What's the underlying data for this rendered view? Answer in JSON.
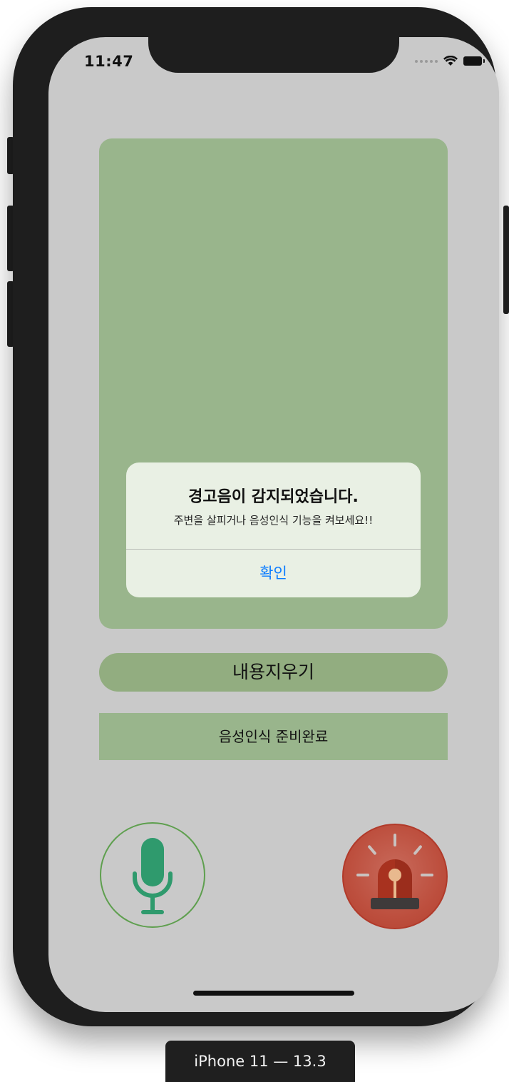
{
  "status_bar": {
    "time": "11:47"
  },
  "alert": {
    "title": "경고음이 감지되었습니다.",
    "message": "주변을 살피거나 음성인식 기능을 켜보세요!!",
    "confirm_label": "확인"
  },
  "controls": {
    "clear_label": "내용지우기",
    "speech_status": "음성인식 준비완료"
  },
  "icons": {
    "mic": "microphone-icon",
    "siren": "siren-icon"
  },
  "colors": {
    "panel": "#99b58c",
    "clear_button": "#92ad80",
    "alert_button_text": "#0a7cff",
    "mic_ring": "#5e9f4e",
    "siren_ring": "#b13a2a"
  },
  "device_label": "iPhone 11 — 13.3"
}
